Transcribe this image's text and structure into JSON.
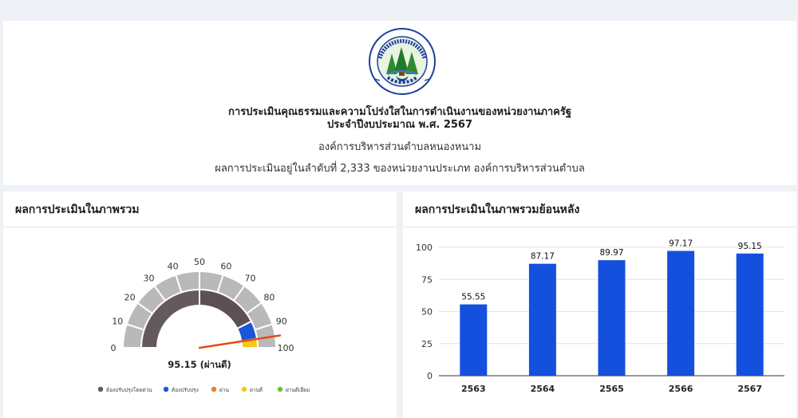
{
  "header": {
    "title_line1": "การประเมินคุณธรรมและความโปร่งใสในการดำเนินงานของหน่วยงานภาครัฐ",
    "title_line2": "ประจำปีงบประมาณ พ.ศ. 2567",
    "org_name": "องค์การบริหารส่วนตำบลหนองหนาม",
    "ranking": "ผลการประเมินอยู่ในลำดับที่ 2,333 ของหน่วยงานประเภท องค์การบริหารส่วนตำบล",
    "logo": {
      "emblem": "seal-with-trees-icon",
      "text_top": "องค์การบริหารส่วนตำบลหนองหนาม",
      "text_bottom_left": "อ.เมือง",
      "text_bottom_right": "จ.ลำพูน"
    }
  },
  "overall_card": {
    "title": "ผลการประเมินในภาพรวม",
    "gauge": {
      "value": 95.15,
      "value_label": "95.15 (ผ่านดี)",
      "min": 0,
      "max": 100,
      "ticks": [
        "0",
        "10",
        "20",
        "30",
        "40",
        "50",
        "60",
        "70",
        "80",
        "90",
        "100"
      ],
      "bands": [
        {
          "from": 0,
          "to": 50,
          "color": "#645a5c"
        },
        {
          "from": 50,
          "to": 85,
          "color": "#5c5053"
        },
        {
          "from": 85,
          "to": 95,
          "color": "#1b56d8"
        },
        {
          "from": 95,
          "to": 100,
          "color": "#f6c915"
        }
      ],
      "legend": [
        {
          "label": "ต้องปรับปรุงโดยด่วน",
          "color": "#645a5c"
        },
        {
          "label": "ต้องปรับปรุง",
          "color": "#1b56d8"
        },
        {
          "label": "ผ่าน",
          "color": "#ee7d20"
        },
        {
          "label": "ผ่านดี",
          "color": "#f6c915"
        },
        {
          "label": "ผ่านดีเยี่ยม",
          "color": "#68c72a"
        }
      ],
      "needle_color": "#e84a12"
    }
  },
  "history_card": {
    "title": "ผลการประเมินในภาพรวมย้อนหลัง"
  },
  "chart_data": {
    "type": "bar",
    "categories": [
      "2563",
      "2564",
      "2565",
      "2566",
      "2567"
    ],
    "values": [
      55.55,
      87.17,
      89.97,
      97.17,
      95.15
    ],
    "value_labels": [
      "55.55",
      "87.17",
      "89.97",
      "97.17",
      "95.15"
    ],
    "yticks": [
      "0",
      "25",
      "50",
      "75",
      "100"
    ],
    "ylim": [
      0,
      100
    ],
    "grid": true,
    "bar_color": "#1450de"
  }
}
